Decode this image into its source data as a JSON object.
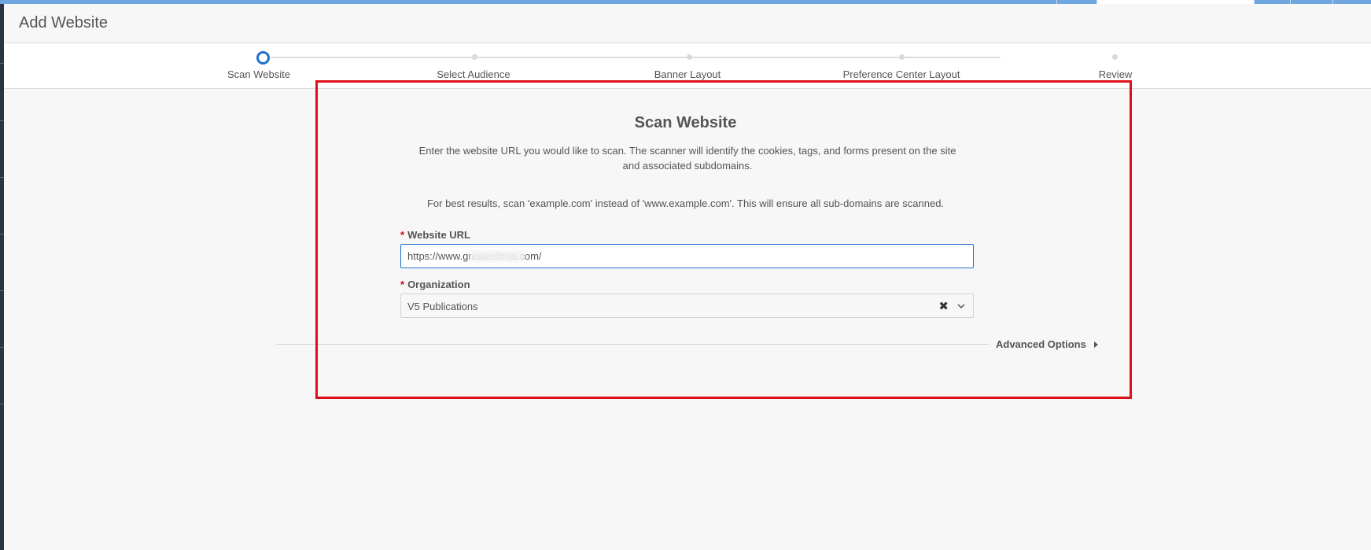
{
  "header": {
    "title": "Add Website"
  },
  "stepper": {
    "steps": [
      {
        "label": "Scan Website",
        "state": "active"
      },
      {
        "label": "Select Audience",
        "state": "pending"
      },
      {
        "label": "Banner Layout",
        "state": "pending"
      },
      {
        "label": "Preference Center Layout",
        "state": "pending"
      },
      {
        "label": "Review",
        "state": "pending"
      }
    ]
  },
  "scan": {
    "title": "Scan Website",
    "description": "Enter the website URL you would like to scan. The scanner will identify the cookies, tags, and forms present on the site and associated subdomains.",
    "tip": "For best results, scan 'example.com' instead of 'www.example.com'. This will ensure all sub-domains are scanned.",
    "website_url": {
      "label": "Website URL",
      "required": "*",
      "value": "https://www.greatexhma.com/"
    },
    "organization": {
      "label": "Organization",
      "required": "*",
      "value": "V5 Publications"
    },
    "advanced_options": "Advanced Options"
  },
  "colors": {
    "accent": "#1f6fcf",
    "highlight": "#e0101a",
    "required": "#d0021b",
    "topbar": "#6ea6e0"
  },
  "icons": {
    "clear": "close-x-icon",
    "dropdown": "chevron-down-icon",
    "expand": "caret-right-icon"
  }
}
